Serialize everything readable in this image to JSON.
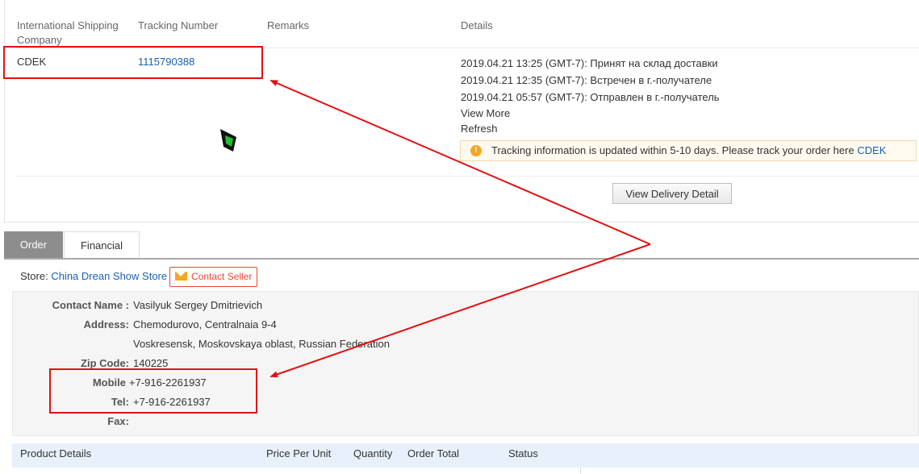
{
  "shipping": {
    "headers": {
      "company_line1": "International Shipping",
      "company_line2": "Company",
      "tracking": "Tracking Number",
      "remarks": "Remarks",
      "details": "Details"
    },
    "company": "CDEK",
    "tracking_number": "1115790388",
    "details": [
      "2019.04.21 13:25 (GMT-7): Принят на склад доставки",
      "2019.04.21 12:35 (GMT-7): Встречен в г.-получателе",
      "2019.04.21 05:57 (GMT-7): Отправлен в г.-получатель"
    ],
    "view_more": "View More",
    "refresh": "Refresh",
    "notice_text": "Tracking information is updated within 5-10 days. Please track your order here",
    "notice_link": "CDEK",
    "view_delivery_button": "View Delivery Detail"
  },
  "tabs": {
    "order": "Order",
    "financial": "Financial"
  },
  "store": {
    "label": "Store:",
    "name": "China Drean Show Store",
    "contact_button": "Contact Seller"
  },
  "address": {
    "contact_name_label": "Contact Name :",
    "contact_name": "Vasilyuk Sergey Dmitrievich",
    "address_label": "Address:",
    "address_line1": "Chemodurovo, Centralnaia 9-4",
    "address_line2": "Voskresensk, Moskovskaya oblast, Russian Federation",
    "zip_label": "Zip Code:",
    "zip": "140225",
    "mobile_label": "Mobile",
    "mobile": "+7-916-2261937",
    "tel_label": "Tel:",
    "tel": "+7-916-2261937",
    "fax_label": "Fax:"
  },
  "products": {
    "headers": {
      "details": "Product Details",
      "price": "Price Per Unit",
      "quantity": "Quantity",
      "total": "Order Total",
      "status": "Status"
    }
  },
  "colors": {
    "annotation_red": "#e31010",
    "link_blue": "#1a5fb4",
    "active_tab": "#8d8d8d"
  }
}
